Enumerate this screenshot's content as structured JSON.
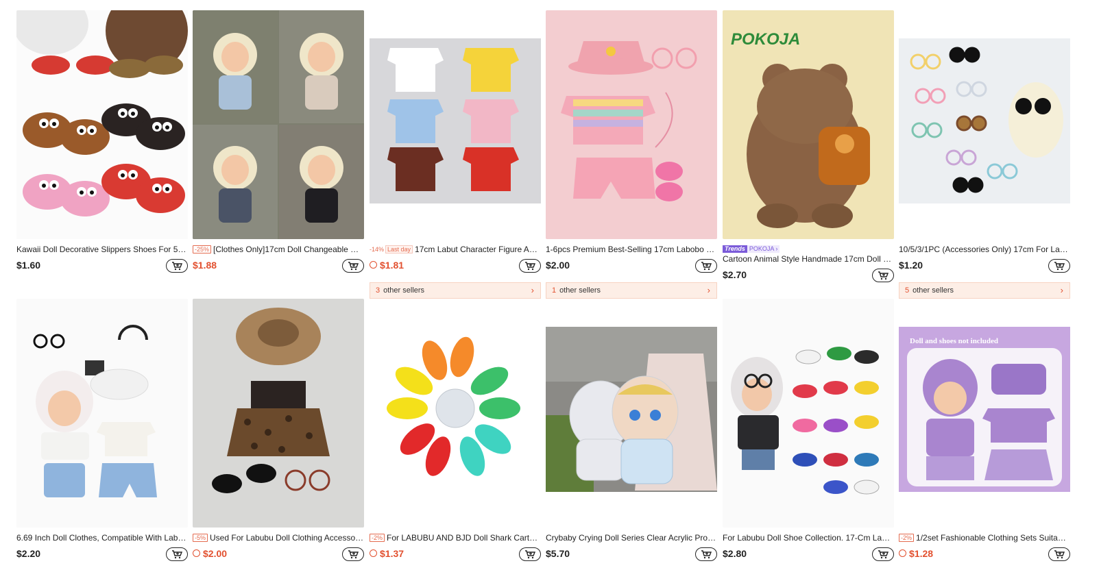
{
  "products": [
    {
      "title": "Kawaii Doll Decorative Slippers Shoes For 5.9-6...",
      "discount": "",
      "last_day": "",
      "price": "$1.60",
      "price_red": false,
      "clock": false,
      "sellers": "",
      "sellers_count": ""
    },
    {
      "title": "[Clothes Only]17cm Doll Changeable Out...",
      "discount": "-25%",
      "last_day": "",
      "price": "$1.88",
      "price_red": true,
      "clock": false,
      "sellers": "",
      "sellers_count": ""
    },
    {
      "title": "17cm Labut Character Figure Acc...",
      "discount": "-14%",
      "last_day": "Last day",
      "price": "$1.81",
      "price_red": true,
      "clock": true,
      "sellers": "other sellers",
      "sellers_count": "3"
    },
    {
      "title": "1-6pcs Premium Best-Selling 17cm Labobo Doll...",
      "discount": "",
      "last_day": "",
      "price": "$2.00",
      "price_red": false,
      "clock": false,
      "sellers": "other sellers",
      "sellers_count": "1"
    },
    {
      "title": "Cartoon Animal Style Handmade 17cm Doll Bac...",
      "trend": "Trends",
      "store": "POKOJA",
      "price": "$2.70",
      "price_red": false,
      "clock": false,
      "sellers": "",
      "sellers_count": ""
    },
    {
      "title": "10/5/3/1PC (Accessories Only) 17cm For Labub...",
      "discount": "",
      "last_day": "",
      "price": "$1.20",
      "price_red": false,
      "clock": false,
      "sellers": "other sellers",
      "sellers_count": "5"
    },
    {
      "title": "6.69 Inch Doll Clothes, Compatible With Labubu...",
      "discount": "",
      "last_day": "",
      "price": "$2.20",
      "price_red": false,
      "clock": false,
      "sellers": "",
      "sellers_count": ""
    },
    {
      "title": "Used For Labubu Doll Clothing Accessorie...",
      "discount": "-5%",
      "last_day": "",
      "price": "$2.00",
      "price_red": true,
      "clock": true,
      "sellers": "",
      "sellers_count": ""
    },
    {
      "title": "For LABUBU AND BJD Doll Shark Cartoon...",
      "discount": "-2%",
      "last_day": "",
      "price": "$1.37",
      "price_red": true,
      "clock": true,
      "sellers": "",
      "sellers_count": ""
    },
    {
      "title": "Crybaby Crying Doll Series Clear Acrylic Protect...",
      "discount": "",
      "last_day": "",
      "price": "$5.70",
      "price_red": false,
      "clock": false,
      "sellers": "",
      "sellers_count": ""
    },
    {
      "title": "For Labubu Doll Shoe Collection. 17-Cm Labub...",
      "discount": "",
      "last_day": "",
      "price": "$2.80",
      "price_red": false,
      "clock": false,
      "sellers": "",
      "sellers_count": ""
    },
    {
      "title": "1/2set Fashionable Clothing Sets Suitable ...",
      "discount": "-2%",
      "last_day": "",
      "price": "$1.28",
      "price_red": true,
      "clock": true,
      "sellers": "",
      "sellers_count": ""
    }
  ],
  "image_text": {
    "pokoja_logo": "POKOJA",
    "purple_banner": "Doll and shoes not included"
  },
  "colors": {
    "sale_red": "#e2502f",
    "trend_purple": "#7b5bd9",
    "sellers_bg": "#fdeee6"
  }
}
